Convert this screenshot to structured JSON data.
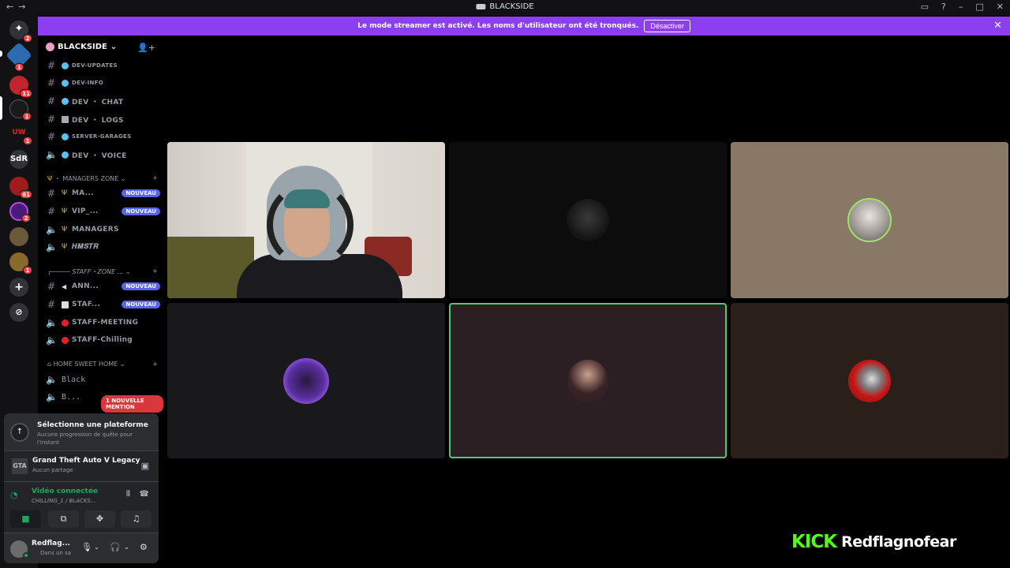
{
  "window": {
    "title": "BLACKSIDE"
  },
  "banner": {
    "message": "Le mode streamer est activé. Les noms d'utilisateur ont été tronqués.",
    "button_label": "Désactiver"
  },
  "servers": [
    {
      "icon": "discord-home-icon",
      "badge": "2"
    },
    {
      "icon": "server-blue-icon",
      "badge": "1"
    },
    {
      "icon": "server-red-icon",
      "badge": "11"
    },
    {
      "icon": "server-blackside-icon",
      "badge": "1"
    },
    {
      "icon": "server-uw-icon",
      "badge": "1"
    },
    {
      "label": "SdR",
      "badge": ""
    },
    {
      "icon": "server-wings-icon",
      "badge": "61"
    },
    {
      "icon": "server-purple-icon",
      "badge": "2"
    },
    {
      "icon": "server-character-icon",
      "badge": ""
    },
    {
      "icon": "server-gold-icon",
      "badge": "1"
    },
    {
      "icon": "add-server-icon",
      "badge": ""
    },
    {
      "icon": "discover-icon",
      "badge": ""
    }
  ],
  "sidebar": {
    "server_name": "BLACKSIDE",
    "channels_top": [
      {
        "label": "DEV-UPDATES",
        "small": true
      },
      {
        "label": "DEV-INFO",
        "small": true
      },
      {
        "label": "DEV ・ CHAT",
        "small": false
      },
      {
        "label": "DEV ・ LOGS",
        "small": false
      },
      {
        "label": "SERVER-GARAGES",
        "small": true
      },
      {
        "label": "DEV ・ VOICE",
        "small": false
      }
    ],
    "categories": {
      "managers": "MANAGERS ZONE",
      "staff": "STAFF・ZONE ...",
      "home": "HOME SWEET HOME"
    },
    "channels_managers": [
      {
        "label": "MA...",
        "badge": "NOUVEAU"
      },
      {
        "label": "VIP_...",
        "badge": "NOUVEAU"
      },
      {
        "label": "MANAGERS",
        "badge": ""
      },
      {
        "label": "𝑯𝑴𝑺𝑻𝑹",
        "badge": ""
      }
    ],
    "channels_staff": [
      {
        "label": "ANN...",
        "badge": "NOUVEAU"
      },
      {
        "label": "STAF...",
        "badge": "NOUVEAU"
      },
      {
        "label": "STAFF-MEETING",
        "badge": ""
      },
      {
        "label": "STAFF-Chilling",
        "badge": ""
      }
    ],
    "channels_home": [
      {
        "label": "Black"
      },
      {
        "label": "B..."
      }
    ],
    "mention_pill": "1 NOUVELLE MENTION"
  },
  "quest": {
    "title": "Sélectionne une plateforme",
    "subtitle": "Aucune progression de quête pour l'instant"
  },
  "activity": {
    "game": "Grand Theft Auto V Legacy",
    "sharing": "Aucun partage",
    "game_short": "GTA"
  },
  "voice": {
    "status": "Vidéo connectée",
    "channel": "CHILLING_1 / BLACKS..."
  },
  "user": {
    "name": "Redflag...",
    "status": "Dans un sa"
  },
  "watermark": {
    "kick": "KICK",
    "channel": "Redflagnofear"
  },
  "colors": {
    "banner": "#8c3ff0",
    "speaking_border": "#50c878",
    "nouveau": "#5865f2",
    "kick": "#53fc18"
  }
}
